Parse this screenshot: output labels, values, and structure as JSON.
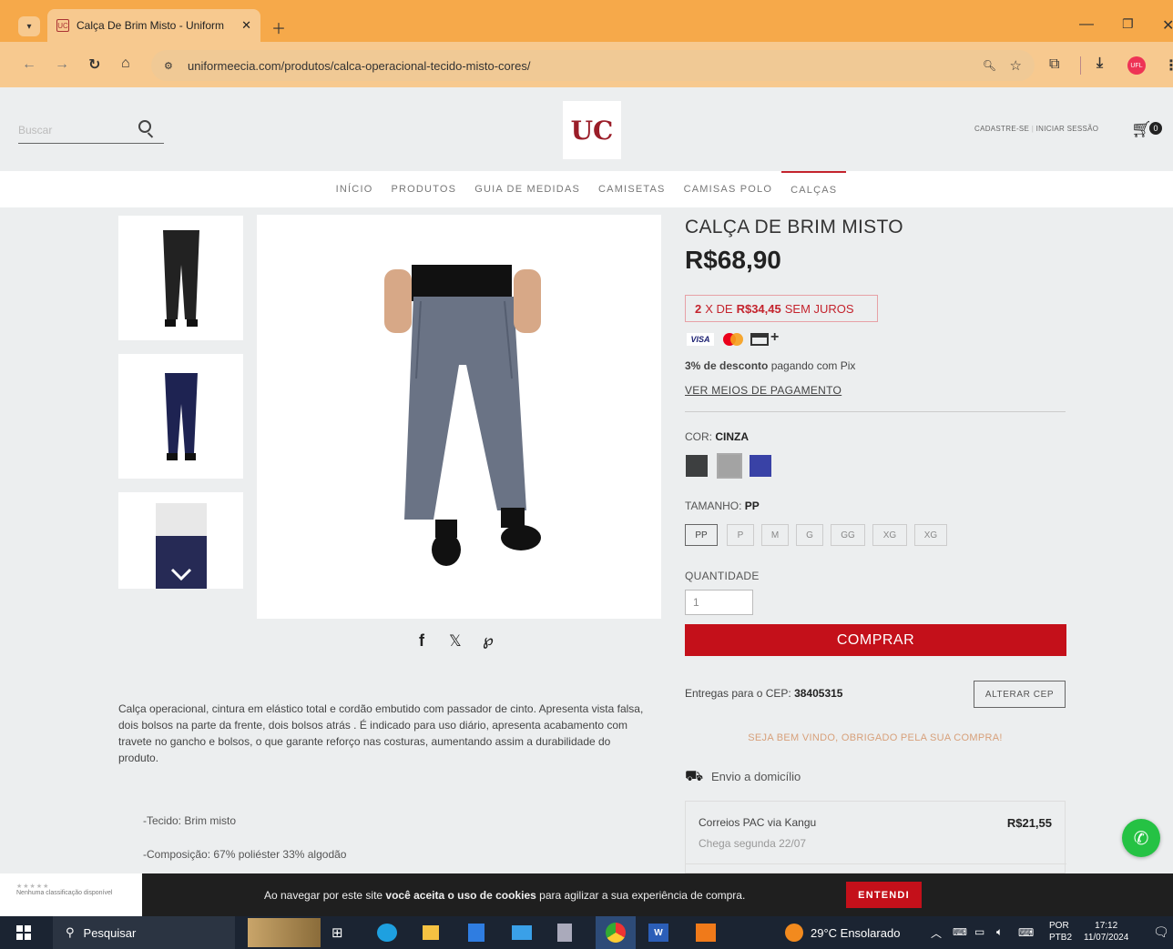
{
  "browser": {
    "tab_title": "Calça De Brim Misto - Uniform",
    "tab_favicon": "UC",
    "url": "uniformeecia.com/produtos/calca-operacional-tecido-misto-cores/"
  },
  "header": {
    "search_placeholder": "Buscar",
    "account_register": "CADASTRE-SE",
    "account_login": "INICIAR SESSÃO",
    "cart_count": "0",
    "logo_text": "UC"
  },
  "nav": [
    "INÍCIO",
    "PRODUTOS",
    "GUIA DE MEDIDAS",
    "CAMISETAS",
    "CAMISAS POLO",
    "CALÇAS"
  ],
  "product": {
    "title": "CALÇA DE BRIM MISTO",
    "price": "R$68,90",
    "installment_prefix": "2",
    "installment_mid": "X DE",
    "installment_value": "R$34,45",
    "installment_suffix": "SEM JUROS",
    "pix_bold": "3% de desconto",
    "pix_rest": "pagando com Pix",
    "payment_link": "VER MEIOS DE PAGAMENTO",
    "color_label": "COR:",
    "color_value": "CINZA",
    "colors": [
      "#3d3f40",
      "#a3a3a3",
      "#3942a6"
    ],
    "size_label": "TAMANHO:",
    "size_value": "PP",
    "sizes": [
      "PP",
      "P",
      "M",
      "G",
      "GG",
      "XG",
      "XG"
    ],
    "qty_label": "QUANTIDADE",
    "qty_value": "1",
    "buy_label": "COMPRAR"
  },
  "shipping": {
    "cep_text": "Entregas para o CEP:",
    "cep_value": "38405315",
    "change_cep": "ALTERAR CEP",
    "welcome": "SEJA BEM VINDO, OBRIGADO PELA SUA COMPRA!",
    "delivery_type": "Envio a domicílio",
    "option_name": "Correios PAC via Kangu",
    "option_date": "Chega segunda 22/07",
    "option_price": "R$21,55"
  },
  "description": {
    "text": "Calça operacional, cintura em elástico total e cordão embutido com passador de cinto. Apresenta vista falsa, dois bolsos na parte da frente, dois bolsos atrás . É indicado para uso diário, apresenta acabamento com travete no gancho e bolsos, o que garante reforço nas costuras, aumentando assim a durabilidade do produto.",
    "spec1": "-Tecido: Brim misto",
    "spec2": "-Composição: 67% poliéster 33% algodão"
  },
  "cookie": {
    "text_before": "Ao navegar por este site",
    "bold": "você aceita o uso de cookies",
    "text_after": "para agilizar a sua experiência de compra.",
    "button": "ENTENDI",
    "rating_text": "Nenhuma classificação disponível"
  },
  "taskbar": {
    "search": "Pesquisar",
    "weather": "29°C  Ensolarado",
    "lang1": "POR",
    "lang2": "PTB2",
    "time": "17:12",
    "date": "11/07/2024"
  },
  "colors": {
    "accent": "#c4101a",
    "tabbar": "#f6a94a",
    "whatsapp": "#25c244"
  }
}
